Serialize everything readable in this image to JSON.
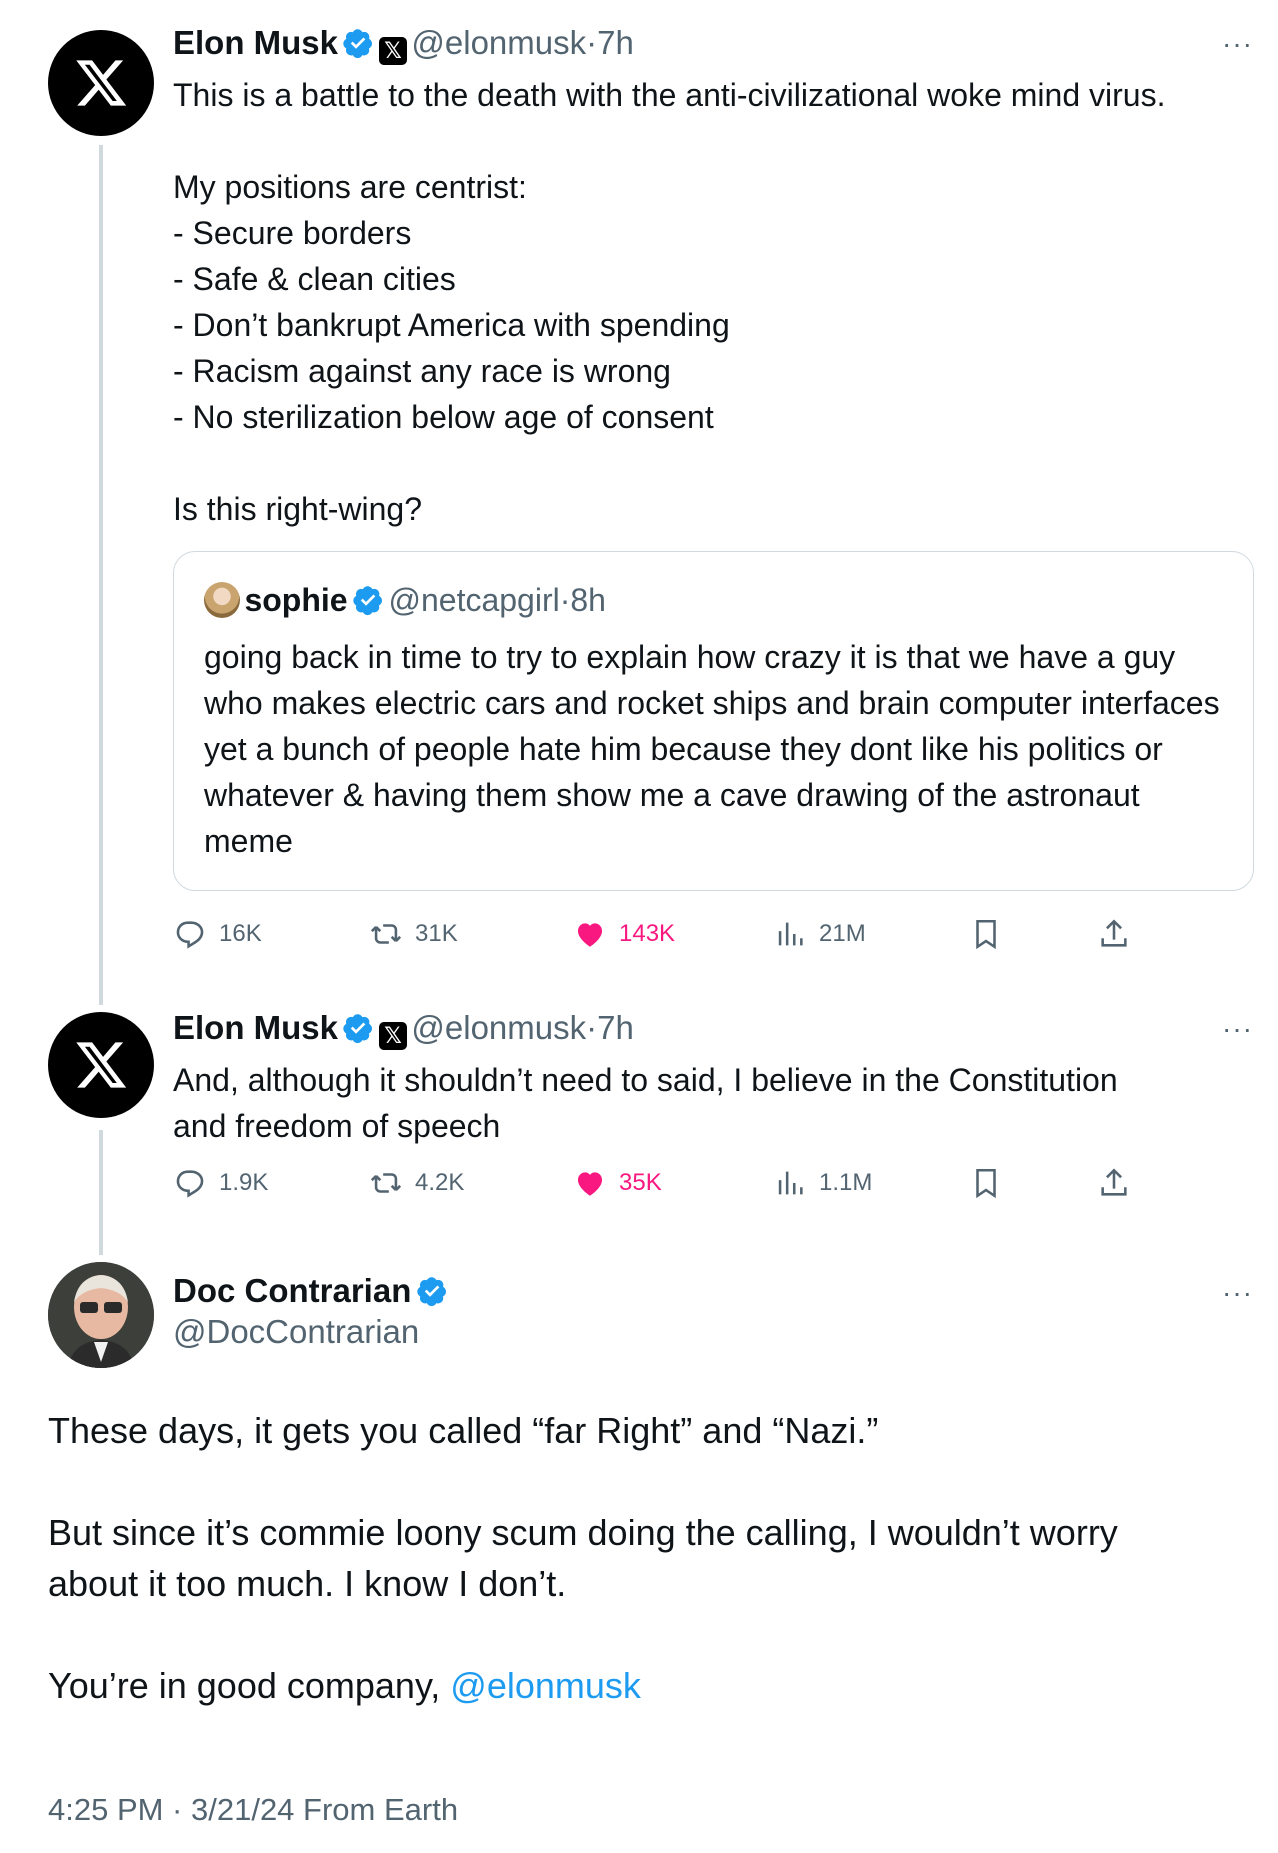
{
  "tweets": [
    {
      "name": "Elon Musk",
      "handle": "@elonmusk",
      "time": "7h",
      "text": "This is a battle to the death with the anti-civilizational woke mind virus.\n\nMy positions are centrist:\n- Secure borders\n- Safe & clean cities\n- Don’t bankrupt America with spending\n- Racism against any race is wrong\n- No sterilization below age of consent\n\nIs this right-wing?",
      "quote": {
        "name": "sophie",
        "handle": "@netcapgirl",
        "time": "8h",
        "text": "going back in time to try to explain how crazy it is that we have a guy who makes electric cars and rocket ships and brain computer interfaces yet a bunch of people hate him because they dont like his politics or whatever & having them show me a cave drawing of the astronaut meme"
      },
      "stats": {
        "replies": "16K",
        "retweets": "31K",
        "likes": "143K",
        "views": "21M"
      }
    },
    {
      "name": "Elon Musk",
      "handle": "@elonmusk",
      "time": "7h",
      "text": "And, although it shouldn’t need to said, I believe in the Constitution\nand freedom of speech",
      "stats": {
        "replies": "1.9K",
        "retweets": "4.2K",
        "likes": "35K",
        "views": "1.1M"
      }
    }
  ],
  "main_tweet": {
    "name": "Doc Contrarian",
    "handle": "@DocContrarian",
    "text_p1": "These days, it gets you called “far Right” and “Nazi.”",
    "text_p2": "But since it’s commie loony scum doing the calling, I wouldn’t worry\nabout it too much. I know I don’t.",
    "text_p3": "You’re in good company, ",
    "mention": "@elonmusk",
    "timestamp": "4:25 PM · 3/21/24 From Earth"
  },
  "separator": "·",
  "more_glyph": "···",
  "colors": {
    "accent": "#1d9bf0",
    "like": "#f91880",
    "secondary": "#536471",
    "thread_line": "#cfd9de"
  },
  "icons": [
    "x-logo-icon",
    "verified-icon",
    "reply-icon",
    "retweet-icon",
    "like-icon",
    "views-icon",
    "bookmark-icon",
    "share-icon",
    "more-icon"
  ]
}
